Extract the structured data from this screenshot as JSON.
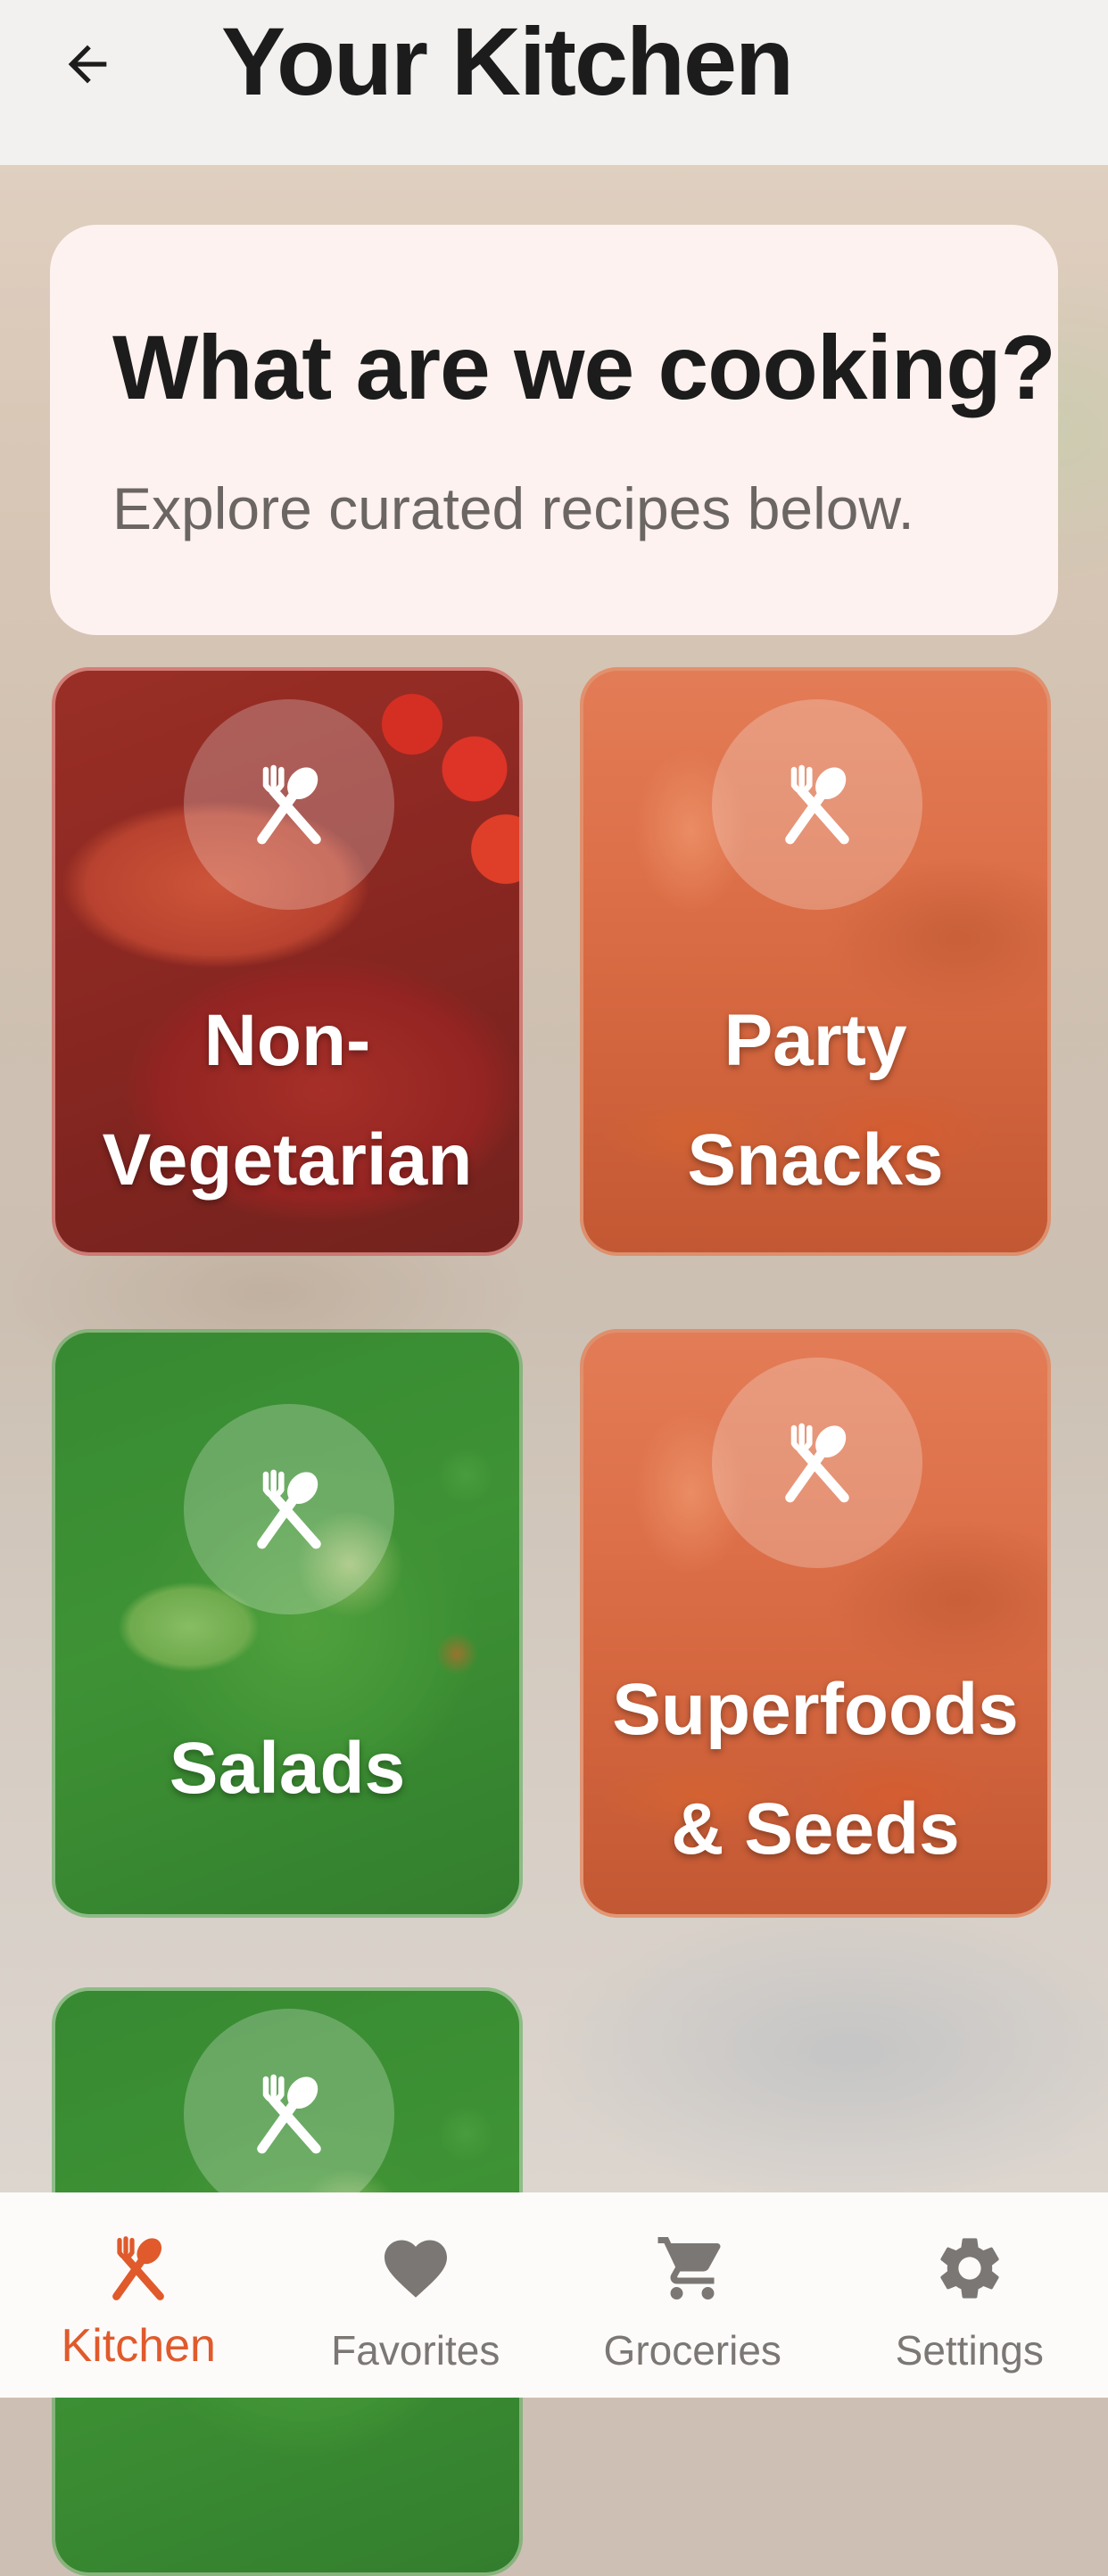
{
  "header": {
    "title": "Your Kitchen",
    "back_icon": "arrow-back-icon"
  },
  "hero": {
    "title": "What are we cooking?",
    "subtitle": "Explore curated recipes below."
  },
  "categories": [
    {
      "label_line1": "Non-",
      "label_line2": "Vegetarian",
      "icon": "fork-spoon-icon",
      "tint": "#d63a3a"
    },
    {
      "label_line1": "Party",
      "label_line2": "Snacks",
      "icon": "fork-spoon-icon",
      "tint": "#ec6436"
    },
    {
      "label_line1": "Salads",
      "icon": "fork-spoon-icon",
      "tint": "#42a042"
    },
    {
      "label_line1": "Superfoods",
      "label_line2": "& Seeds",
      "icon": "fork-spoon-icon",
      "tint": "#ec6436"
    },
    {
      "icon": "fork-spoon-icon",
      "tint": "#42a042"
    }
  ],
  "bottom_nav": {
    "items": [
      {
        "label": "Kitchen",
        "icon": "fork-spoon-icon",
        "active": true
      },
      {
        "label": "Favorites",
        "icon": "heart-icon",
        "active": false
      },
      {
        "label": "Groceries",
        "icon": "cart-icon",
        "active": false
      },
      {
        "label": "Settings",
        "icon": "gear-icon",
        "active": false
      }
    ]
  },
  "colors": {
    "accent": "#e05a2b",
    "inactive_nav": "#7b7774",
    "app_bar": "#f3f1ef",
    "hero_card": "#fdf2ef"
  }
}
